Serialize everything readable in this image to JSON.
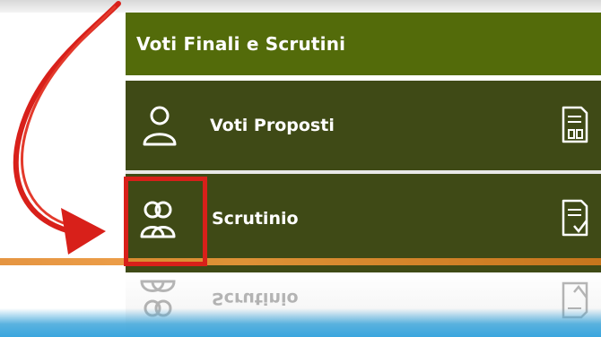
{
  "panel": {
    "title": "Voti Finali e Scrutini",
    "items": [
      {
        "label": "Voti Proposti",
        "icon": "user-icon",
        "doc_icon": "document-users-icon"
      },
      {
        "label": "Scrutinio",
        "icon": "users-group-icon",
        "doc_icon": "document-check-icon"
      }
    ],
    "reflection_label": "Scrutinio"
  },
  "colors": {
    "header_bg": "#536b0a",
    "panel_bg": "#3f4a16",
    "annotation": "#d8201a",
    "orange_stripe": "#e2892c",
    "blue_stripe": "#3aa6de"
  }
}
